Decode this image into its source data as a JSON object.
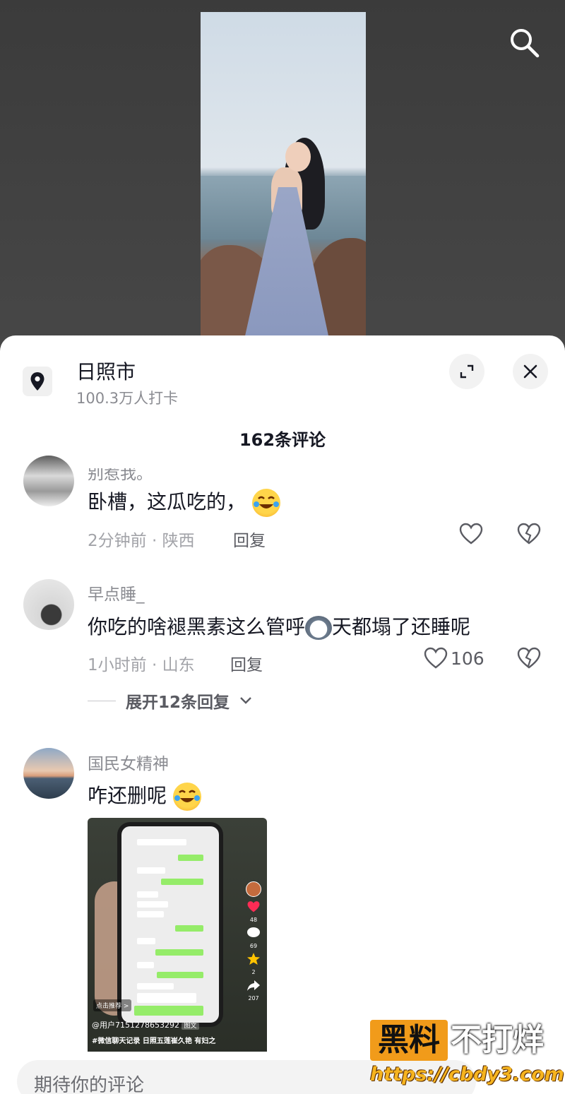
{
  "video": {
    "search_icon": "search-icon"
  },
  "sheet": {
    "location": {
      "icon": "location-pin-icon",
      "title": "日照市",
      "subtitle": "100.3万人打卡"
    },
    "expand_icon": "expand-icon",
    "close_icon": "close-icon",
    "comment_count": "162条评论"
  },
  "comments": [
    {
      "name": "别惹我。",
      "text": "卧槽，这瓜吃的，",
      "emoji": "laugh-cry-emoji",
      "time_location": "2分钟前 · 陕西",
      "reply_label": "回复",
      "likes": ""
    },
    {
      "name": "早点睡_",
      "text_part1": "你吃的啥褪黑素这么管呼",
      "emoji": "husky-emoji",
      "text_part2": "天都塌了还睡呢",
      "time_location": "1小时前 · 山东",
      "reply_label": "回复",
      "likes": "106",
      "expand_replies": "展开12条回复"
    },
    {
      "name": "国民女精神",
      "text": "咋还删呢",
      "emoji": "laugh-cry-emoji",
      "image": {
        "tag": "点击推荐 >",
        "user": "@用户7151278653292",
        "user_badge": "图文",
        "desc": "#微信聊天记录 日照五莲崔久艳 有妇之",
        "side_counts": [
          "48",
          "69",
          "2",
          "207"
        ]
      }
    }
  ],
  "input": {
    "placeholder": "期待你的评论"
  },
  "watermark": {
    "left": "黑料",
    "right": "不打烊",
    "url": "https://cbdy3.com"
  },
  "colors": {
    "accent_red": "#fe2c55",
    "watermark_orange": "#f19b1a"
  }
}
